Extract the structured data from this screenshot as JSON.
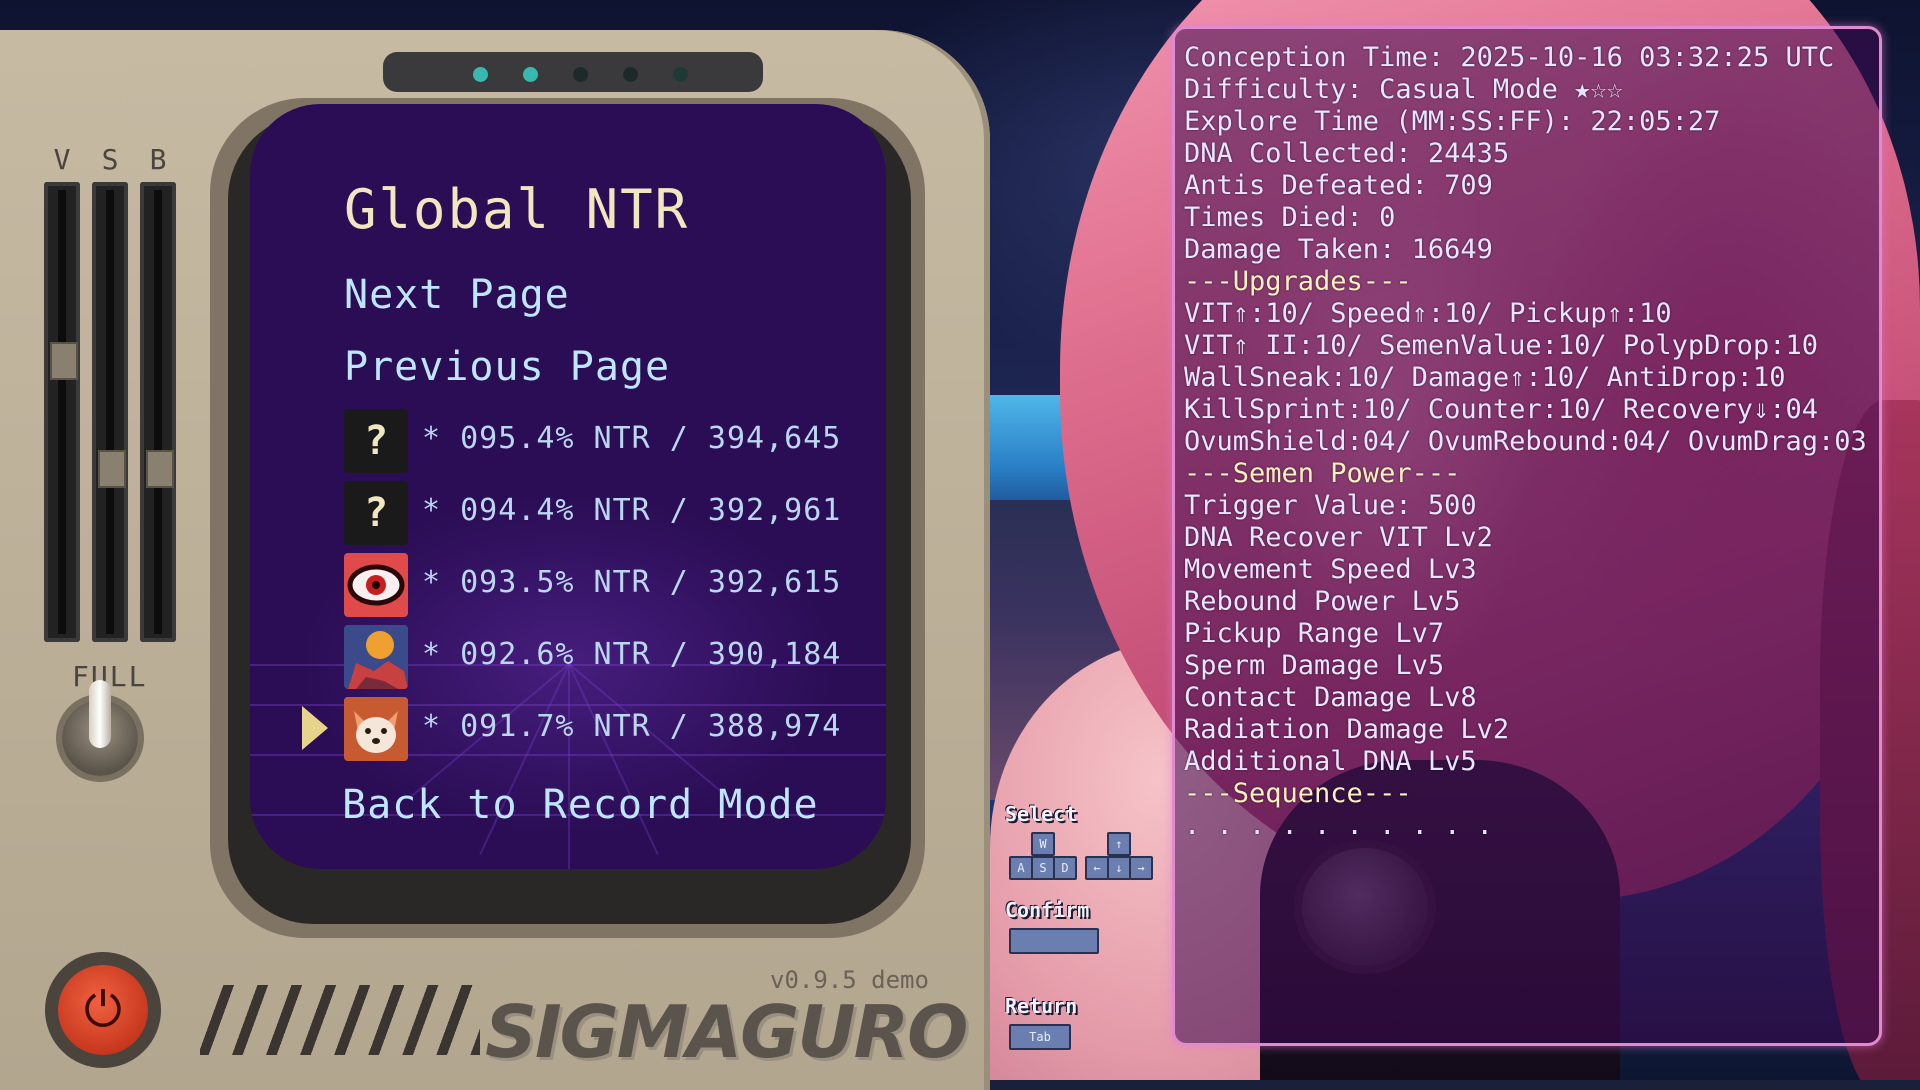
{
  "menu": {
    "title": "Global NTR",
    "next_page": "Next Page",
    "previous_page": "Previous Page",
    "back": "Back to Record Mode"
  },
  "records": [
    {
      "thumb": "?",
      "icon": "unknown-icon",
      "text": "* 095.4% NTR / 394,645"
    },
    {
      "thumb": "?",
      "icon": "unknown-icon",
      "text": "* 094.4% NTR / 392,961"
    },
    {
      "thumb": "",
      "icon": "eye-monster-icon",
      "text": "* 093.5% NTR / 392,615"
    },
    {
      "thumb": "",
      "icon": "planet-icon",
      "text": "* 092.6% NTR / 390,184"
    },
    {
      "thumb": "",
      "icon": "fox-icon",
      "text": "* 091.7% NTR / 388,974"
    }
  ],
  "selected_record": 5,
  "device": {
    "slider_labels": [
      "V",
      "S",
      "B"
    ],
    "slider_levels": [
      0.62,
      0.35,
      0.35
    ],
    "toggle_label": "FULL",
    "version": "v0.9.5 demo",
    "logo": "SIGMAGURO",
    "leds": [
      "#37b8b0",
      "#37b8b0",
      "#1e2a2a",
      "#1e2a2a",
      "#1e3a36"
    ]
  },
  "controls": {
    "select_label": "Select",
    "wasd": [
      "W",
      "A",
      "S",
      "D"
    ],
    "arrows": [
      "↑",
      "←",
      "↓",
      "→"
    ],
    "confirm_label": "Confirm",
    "return_label": "Return",
    "return_key": "Tab"
  },
  "stats": [
    "Conception Time: 2025-10-16 03:32:25 UTC",
    "Difficulty: Casual Mode ★☆☆",
    "Explore Time (MM:SS:FF): 22:05:27",
    "DNA Collected: 24435",
    "Antis Defeated: 709",
    "Times Died: 0",
    "Damage Taken: 16649",
    "---Upgrades---",
    "VIT⇑:10/ Speed⇑:10/ Pickup⇑:10",
    "VIT⇑ II:10/ SemenValue:10/ PolypDrop:10",
    "WallSneak:10/ Damage⇑:10/ AntiDrop:10",
    "KillSprint:10/ Counter:10/ Recovery⇓:04",
    "OvumShield:04/ OvumRebound:04/ OvumDrag:03",
    "---Semen Power---",
    "Trigger Value: 500",
    "DNA Recover VIT Lv2",
    "Movement Speed Lv3",
    "Rebound Power Lv5",
    "Pickup Range Lv7",
    "Sperm Damage Lv5",
    "Contact Damage Lv8",
    "Radiation Damage Lv2",
    "Additional DNA Lv5",
    "---Sequence---",
    ". . . . . . . . . ."
  ],
  "colors": {
    "screen_bg": "#2b0d55",
    "title": "#f0e6c0",
    "menu_text": "#bfe6ff",
    "panel_border": "#e08ad0",
    "section_header": "#fff1c0"
  }
}
